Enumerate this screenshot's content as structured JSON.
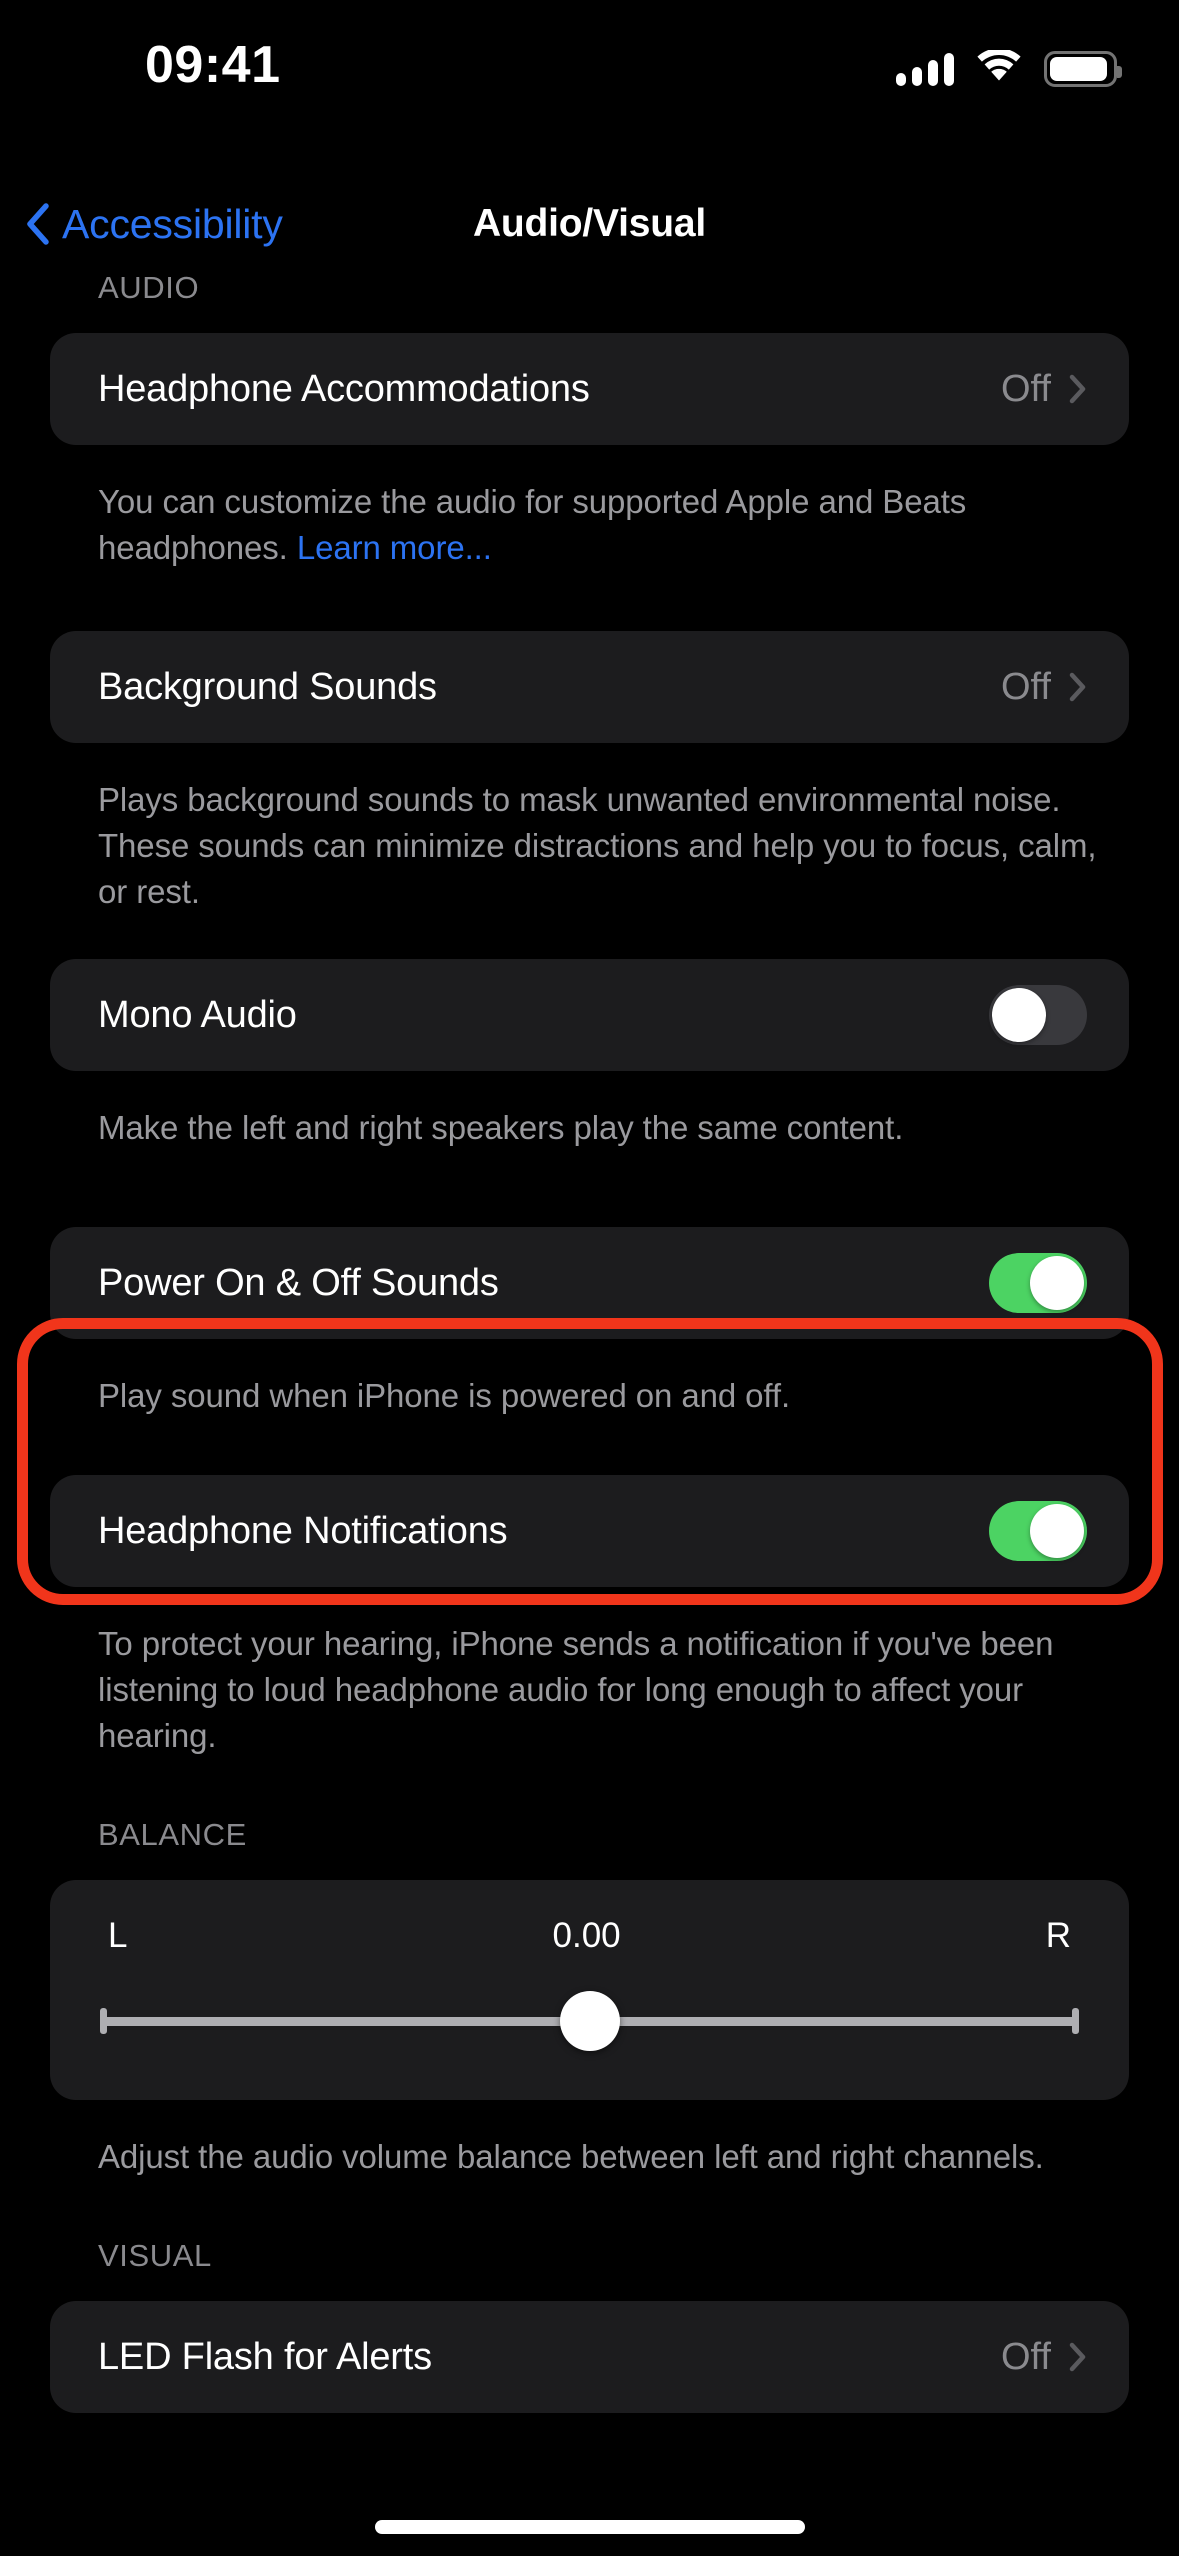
{
  "status_bar": {
    "time": "09:41",
    "signal_icon": "cellular-signal-icon",
    "wifi_icon": "wifi-icon",
    "battery_icon": "battery-icon"
  },
  "nav": {
    "back_label": "Accessibility",
    "title": "Audio/Visual"
  },
  "sections": {
    "audio": {
      "header": "AUDIO",
      "headphone_accommodations": {
        "label": "Headphone Accommodations",
        "value": "Off"
      },
      "headphone_accommodations_footer": {
        "text": "You can customize the audio for supported Apple and Beats headphones. ",
        "link": "Learn more..."
      },
      "background_sounds": {
        "label": "Background Sounds",
        "value": "Off"
      },
      "background_sounds_footer": "Plays background sounds to mask unwanted environmental noise. These sounds can minimize distractions and help you to focus, calm, or rest.",
      "mono_audio": {
        "label": "Mono Audio",
        "state": "off"
      },
      "mono_audio_footer": "Make the left and right speakers play the same content.",
      "power_sounds": {
        "label": "Power On & Off Sounds",
        "state": "on"
      },
      "power_sounds_footer": "Play sound when iPhone is powered on and off.",
      "headphone_notifications": {
        "label": "Headphone Notifications",
        "state": "on"
      },
      "headphone_notifications_footer": "To protect your hearing, iPhone sends a notification if you've been listening to loud headphone audio for long enough to affect your hearing."
    },
    "balance": {
      "header": "BALANCE",
      "left_label": "L",
      "right_label": "R",
      "value": "0.00",
      "footer": "Adjust the audio volume balance between left and right channels."
    },
    "visual": {
      "header": "VISUAL",
      "led_flash": {
        "label": "LED Flash for Alerts",
        "value": "Off"
      }
    }
  },
  "annotation": {
    "highlight_color": "#F1351B",
    "target": "Power On & Off Sounds"
  },
  "colors": {
    "background": "#000000",
    "card": "#1C1C1E",
    "accent_blue": "#2C73F2",
    "toggle_on_green": "#4CD363",
    "toggle_off_gray": "#39393D",
    "secondary_text": "#8A8A8E"
  }
}
